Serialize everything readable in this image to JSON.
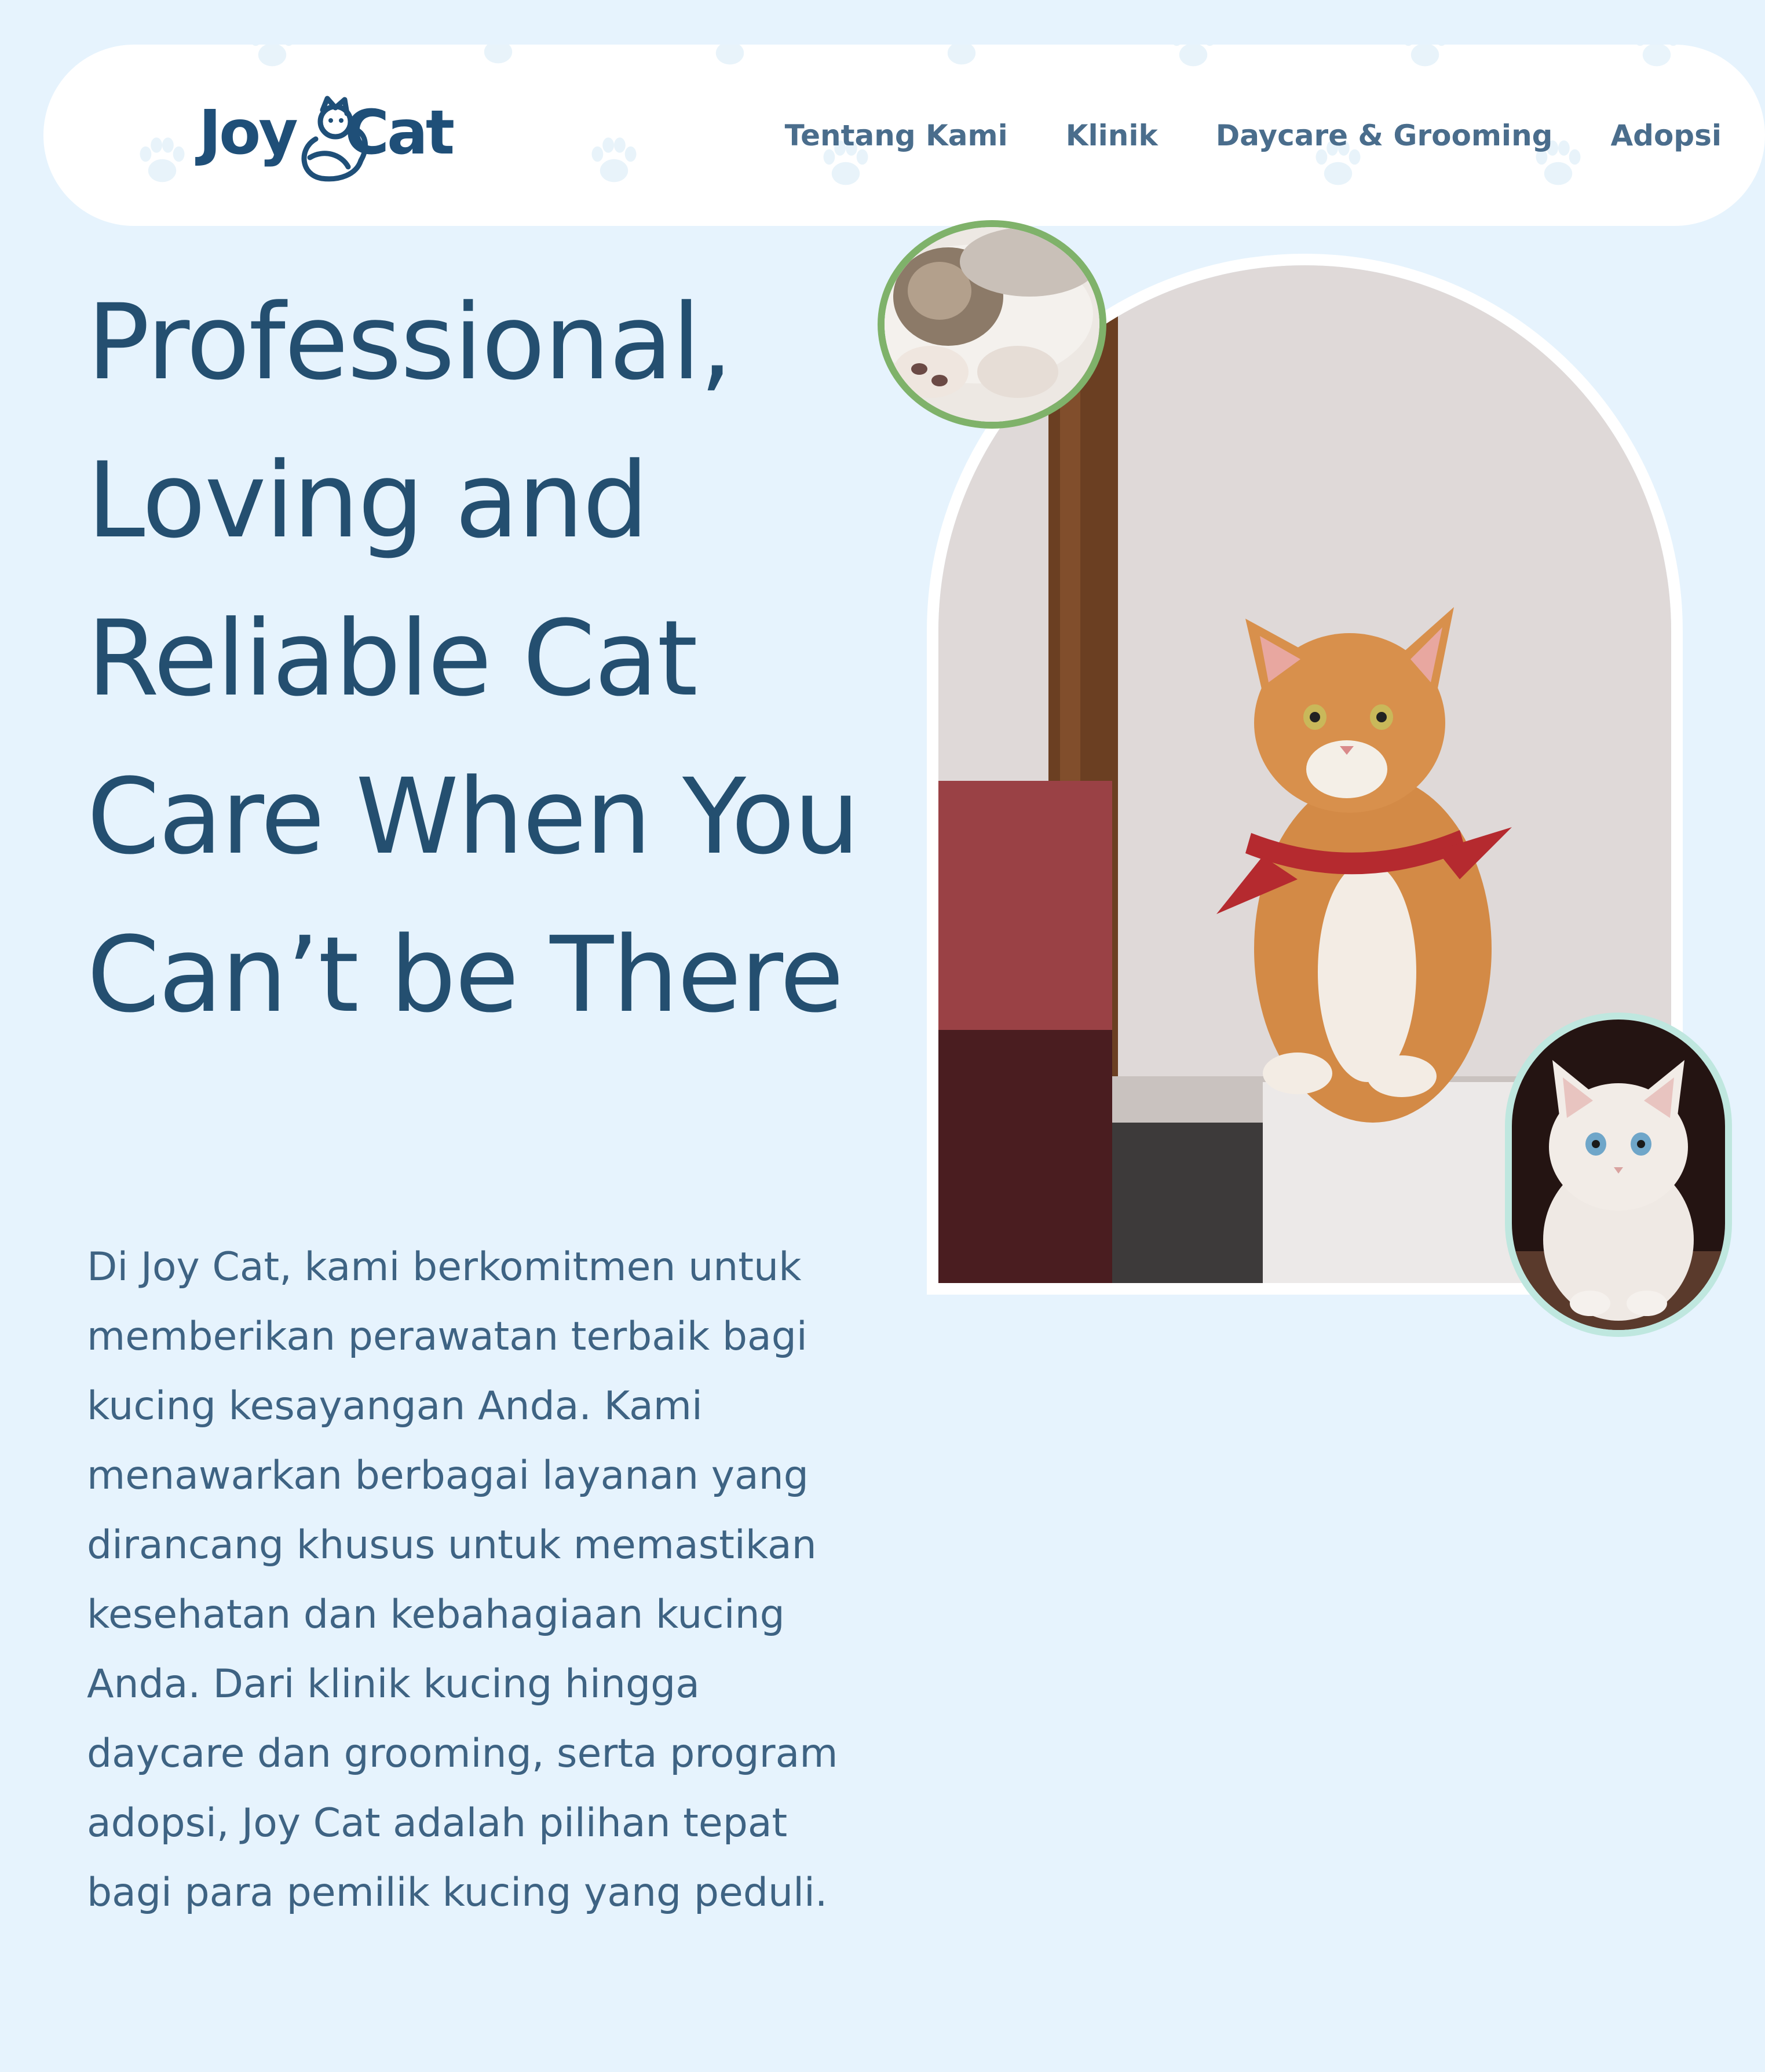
{
  "nav": {
    "logo_word_1": "Joy",
    "logo_word_2": "Cat",
    "links": [
      {
        "label": "Tentang Kami"
      },
      {
        "label": "Klinik"
      },
      {
        "label": "Daycare & Grooming"
      },
      {
        "label": "Adopsi"
      }
    ],
    "decor_icon": "paw-print-icon"
  },
  "hero": {
    "headline": "Professional, Loving and Reliable Cat Care When You Can’t be There",
    "description": "Di Joy Cat, kami berkomitmen untuk memberikan perawatan terbaik bagi kucing kesayangan Anda. Kami menawarkan berbagai layanan yang dirancang khusus untuk memastikan kesehatan dan kebahagiaan kucing Anda. Dari klinik kucing hingga daycare dan grooming, serta program adopsi, Joy Cat adalah pilihan tepat bagi para pemilik kucing yang peduli."
  },
  "colors": {
    "page_background": "#e6f3fd",
    "nav_background": "#ffffff",
    "brand_navy": "#1f4f78",
    "headline": "#244f70",
    "nav_link": "#4a6d8c",
    "body_text": "#3e6383",
    "top_photo_ring": "#7fb26a",
    "bottom_photo_ring": "#bfe7df"
  },
  "images": {
    "main": "ginger-cat-with-red-bandana-photo",
    "top_circle": "sleeping-tabby-cat-photo",
    "bottom_oval": "white-kitten-photo"
  }
}
